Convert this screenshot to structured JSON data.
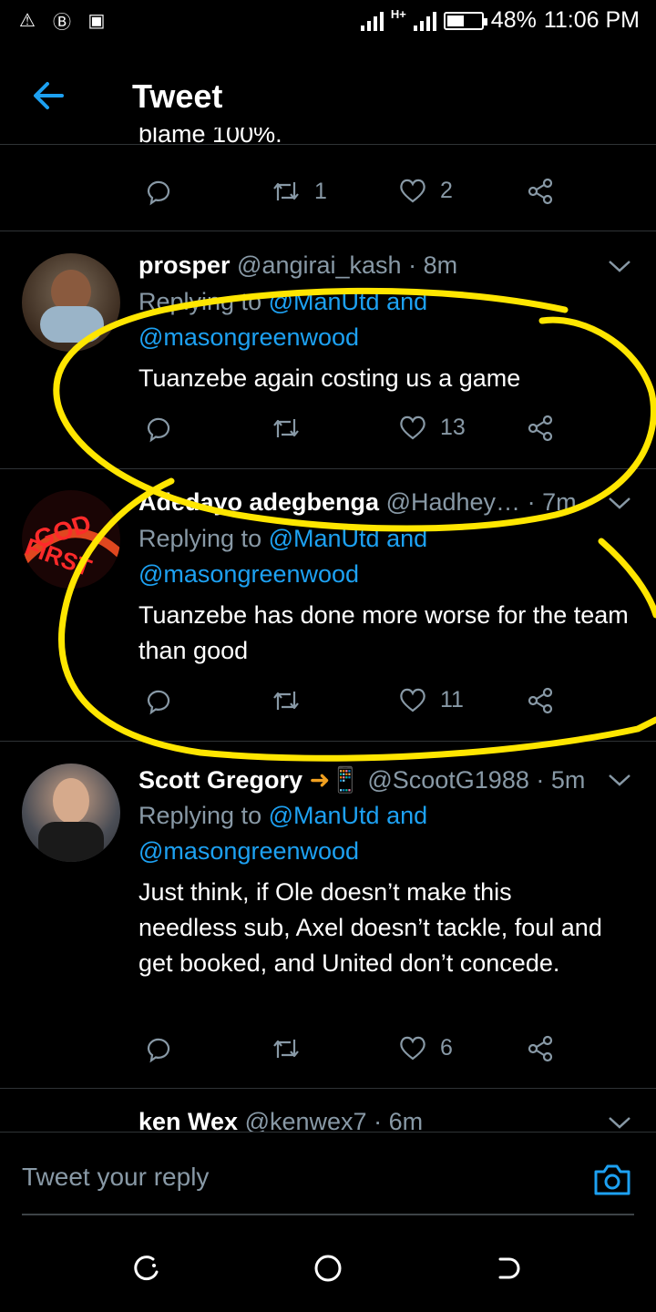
{
  "status_bar": {
    "battery": "48%",
    "time": "11:06 PM",
    "network": "H+",
    "battery_level": 0.48
  },
  "header": {
    "title": "Tweet"
  },
  "partial_tweet": {
    "text": "blame 100%.",
    "retweets": "1",
    "likes": "2"
  },
  "tweets": [
    {
      "name": "prosper",
      "handle": "@angirai_kash",
      "time": "· 8m",
      "replying_prefix": "Replying to",
      "mention1": "@ManUtd",
      "and": "and",
      "mention2": "@masongreenwood",
      "text": "Tuanzebe again costing us a game",
      "retweets": "",
      "likes": "13"
    },
    {
      "name": "Adedayo adegbenga",
      "handle": "@Hadhey…",
      "time": "· 7m",
      "replying_prefix": "Replying to",
      "mention1": "@ManUtd",
      "and": "and",
      "mention2": "@masongreenwood",
      "text": "Tuanzebe has done more  worse for the team than good",
      "retweets": "",
      "likes": "11",
      "avatar_text": "GOD FIRST"
    },
    {
      "name": "Scott Gregory",
      "badge": "➜📱",
      "handle": "@ScootG1988",
      "time": "· 5m",
      "replying_prefix": "Replying to",
      "mention1": "@ManUtd",
      "and": "and",
      "mention2": "@masongreenwood",
      "text": "Just think, if Ole doesn’t make this needless sub, Axel doesn’t tackle, foul and get booked, and United don’t concede.",
      "retweets": "",
      "likes": "6"
    },
    {
      "name": "ken Wex",
      "handle": "@kenwex7",
      "time": "· 6m"
    }
  ],
  "reply_bar": {
    "placeholder": "Tweet your reply"
  },
  "colors": {
    "accent": "#1da1f2",
    "muted": "#8899a6",
    "highlight": "#ffe600"
  },
  "icons": [
    "back-arrow-icon",
    "reply-icon",
    "retweet-icon",
    "like-icon",
    "share-icon",
    "chevron-down-icon",
    "camera-icon",
    "recents-icon",
    "home-icon",
    "back-icon"
  ]
}
